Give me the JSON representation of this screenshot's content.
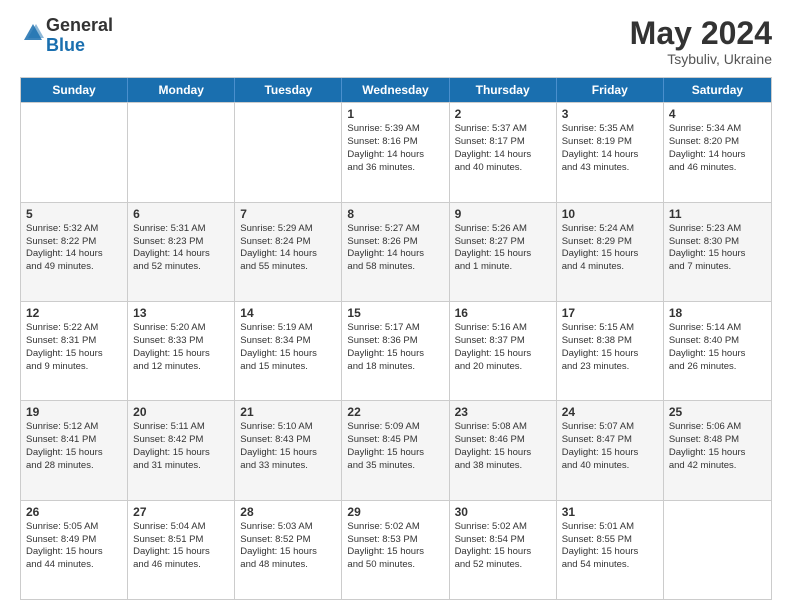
{
  "header": {
    "logo_general": "General",
    "logo_blue": "Blue",
    "month_title": "May 2024",
    "subtitle": "Tsybuliv, Ukraine"
  },
  "weekdays": [
    "Sunday",
    "Monday",
    "Tuesday",
    "Wednesday",
    "Thursday",
    "Friday",
    "Saturday"
  ],
  "rows": [
    {
      "alt": false,
      "cells": [
        {
          "day": "",
          "info": ""
        },
        {
          "day": "",
          "info": ""
        },
        {
          "day": "",
          "info": ""
        },
        {
          "day": "1",
          "info": "Sunrise: 5:39 AM\nSunset: 8:16 PM\nDaylight: 14 hours\nand 36 minutes."
        },
        {
          "day": "2",
          "info": "Sunrise: 5:37 AM\nSunset: 8:17 PM\nDaylight: 14 hours\nand 40 minutes."
        },
        {
          "day": "3",
          "info": "Sunrise: 5:35 AM\nSunset: 8:19 PM\nDaylight: 14 hours\nand 43 minutes."
        },
        {
          "day": "4",
          "info": "Sunrise: 5:34 AM\nSunset: 8:20 PM\nDaylight: 14 hours\nand 46 minutes."
        }
      ]
    },
    {
      "alt": true,
      "cells": [
        {
          "day": "5",
          "info": "Sunrise: 5:32 AM\nSunset: 8:22 PM\nDaylight: 14 hours\nand 49 minutes."
        },
        {
          "day": "6",
          "info": "Sunrise: 5:31 AM\nSunset: 8:23 PM\nDaylight: 14 hours\nand 52 minutes."
        },
        {
          "day": "7",
          "info": "Sunrise: 5:29 AM\nSunset: 8:24 PM\nDaylight: 14 hours\nand 55 minutes."
        },
        {
          "day": "8",
          "info": "Sunrise: 5:27 AM\nSunset: 8:26 PM\nDaylight: 14 hours\nand 58 minutes."
        },
        {
          "day": "9",
          "info": "Sunrise: 5:26 AM\nSunset: 8:27 PM\nDaylight: 15 hours\nand 1 minute."
        },
        {
          "day": "10",
          "info": "Sunrise: 5:24 AM\nSunset: 8:29 PM\nDaylight: 15 hours\nand 4 minutes."
        },
        {
          "day": "11",
          "info": "Sunrise: 5:23 AM\nSunset: 8:30 PM\nDaylight: 15 hours\nand 7 minutes."
        }
      ]
    },
    {
      "alt": false,
      "cells": [
        {
          "day": "12",
          "info": "Sunrise: 5:22 AM\nSunset: 8:31 PM\nDaylight: 15 hours\nand 9 minutes."
        },
        {
          "day": "13",
          "info": "Sunrise: 5:20 AM\nSunset: 8:33 PM\nDaylight: 15 hours\nand 12 minutes."
        },
        {
          "day": "14",
          "info": "Sunrise: 5:19 AM\nSunset: 8:34 PM\nDaylight: 15 hours\nand 15 minutes."
        },
        {
          "day": "15",
          "info": "Sunrise: 5:17 AM\nSunset: 8:36 PM\nDaylight: 15 hours\nand 18 minutes."
        },
        {
          "day": "16",
          "info": "Sunrise: 5:16 AM\nSunset: 8:37 PM\nDaylight: 15 hours\nand 20 minutes."
        },
        {
          "day": "17",
          "info": "Sunrise: 5:15 AM\nSunset: 8:38 PM\nDaylight: 15 hours\nand 23 minutes."
        },
        {
          "day": "18",
          "info": "Sunrise: 5:14 AM\nSunset: 8:40 PM\nDaylight: 15 hours\nand 26 minutes."
        }
      ]
    },
    {
      "alt": true,
      "cells": [
        {
          "day": "19",
          "info": "Sunrise: 5:12 AM\nSunset: 8:41 PM\nDaylight: 15 hours\nand 28 minutes."
        },
        {
          "day": "20",
          "info": "Sunrise: 5:11 AM\nSunset: 8:42 PM\nDaylight: 15 hours\nand 31 minutes."
        },
        {
          "day": "21",
          "info": "Sunrise: 5:10 AM\nSunset: 8:43 PM\nDaylight: 15 hours\nand 33 minutes."
        },
        {
          "day": "22",
          "info": "Sunrise: 5:09 AM\nSunset: 8:45 PM\nDaylight: 15 hours\nand 35 minutes."
        },
        {
          "day": "23",
          "info": "Sunrise: 5:08 AM\nSunset: 8:46 PM\nDaylight: 15 hours\nand 38 minutes."
        },
        {
          "day": "24",
          "info": "Sunrise: 5:07 AM\nSunset: 8:47 PM\nDaylight: 15 hours\nand 40 minutes."
        },
        {
          "day": "25",
          "info": "Sunrise: 5:06 AM\nSunset: 8:48 PM\nDaylight: 15 hours\nand 42 minutes."
        }
      ]
    },
    {
      "alt": false,
      "cells": [
        {
          "day": "26",
          "info": "Sunrise: 5:05 AM\nSunset: 8:49 PM\nDaylight: 15 hours\nand 44 minutes."
        },
        {
          "day": "27",
          "info": "Sunrise: 5:04 AM\nSunset: 8:51 PM\nDaylight: 15 hours\nand 46 minutes."
        },
        {
          "day": "28",
          "info": "Sunrise: 5:03 AM\nSunset: 8:52 PM\nDaylight: 15 hours\nand 48 minutes."
        },
        {
          "day": "29",
          "info": "Sunrise: 5:02 AM\nSunset: 8:53 PM\nDaylight: 15 hours\nand 50 minutes."
        },
        {
          "day": "30",
          "info": "Sunrise: 5:02 AM\nSunset: 8:54 PM\nDaylight: 15 hours\nand 52 minutes."
        },
        {
          "day": "31",
          "info": "Sunrise: 5:01 AM\nSunset: 8:55 PM\nDaylight: 15 hours\nand 54 minutes."
        },
        {
          "day": "",
          "info": ""
        }
      ]
    }
  ]
}
